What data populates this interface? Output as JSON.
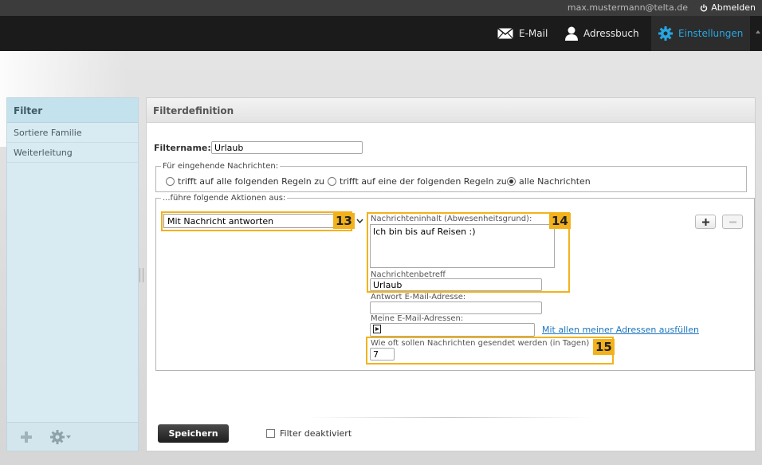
{
  "topbar": {
    "user_email": "max.mustermann@telta.de",
    "logout_label": "Abmelden"
  },
  "nav": {
    "items": [
      {
        "label": "E-Mail",
        "icon": "envelope-icon"
      },
      {
        "label": "Adressbuch",
        "icon": "person-icon"
      },
      {
        "label": "Einstellungen",
        "icon": "gear-icon",
        "active": true
      }
    ]
  },
  "sidebar": {
    "title": "Filter",
    "items": [
      {
        "label": "Sortiere Familie"
      },
      {
        "label": "Weiterleitung"
      }
    ]
  },
  "panel": {
    "title": "Filterdefinition",
    "filtername_label": "Filtername:",
    "filtername_value": "Urlaub",
    "incoming": {
      "legend": "Für eingehende Nachrichten:",
      "options": [
        {
          "label": "trifft auf alle folgenden Regeln zu",
          "selected": false
        },
        {
          "label": "trifft auf eine der folgenden Regeln zu",
          "selected": false
        },
        {
          "label": "alle Nachrichten",
          "selected": true
        }
      ]
    },
    "actions": {
      "legend": "...führe folgende Aktionen aus:",
      "action_select": "Mit Nachricht antworten",
      "message_content_label": "Nachrichteninhalt (Abwesenheitsgrund):",
      "message_content_value": "Ich bin bis auf Reisen :)",
      "subject_label": "Nachrichtenbetreff",
      "subject_value": "Urlaub",
      "reply_address_label": "Antwort E-Mail-Adresse:",
      "reply_address_value": "",
      "my_addresses_label": "Meine E-Mail-Adressen:",
      "fill_all_link": "Mit allen meiner Adressen ausfüllen",
      "frequency_label": "Wie oft sollen Nachrichten gesendet werden (in Tagen)",
      "frequency_value": "7"
    },
    "annotations": [
      "13",
      "14",
      "15"
    ],
    "save_label": "Speichern",
    "disable_label": "Filter deaktiviert"
  },
  "colors": {
    "accent": "#27a7e3",
    "highlight": "#f3b21c"
  }
}
